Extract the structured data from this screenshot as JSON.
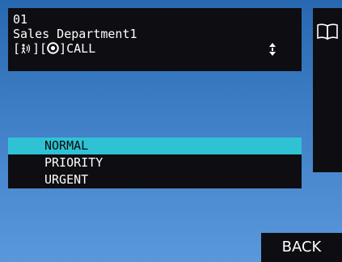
{
  "info": {
    "number": "01",
    "name": "Sales Department1",
    "call_prefix": "[",
    "call_mid": "][",
    "call_suffix": "]CALL",
    "broadcast_icon": "broadcast-icon",
    "target_icon": "target-circle-icon",
    "scroll_icon": "scroll-updown-icon"
  },
  "side": {
    "icon": "book-icon"
  },
  "options": [
    {
      "label": "NORMAL",
      "selected": true
    },
    {
      "label": "PRIORITY",
      "selected": false
    },
    {
      "label": "URGENT",
      "selected": false
    }
  ],
  "back_label": "BACK",
  "colors": {
    "panel": "#0d0d12",
    "highlight": "#2fc2d4",
    "background_top": "#2868b0",
    "background_bottom": "#5a98dc"
  }
}
